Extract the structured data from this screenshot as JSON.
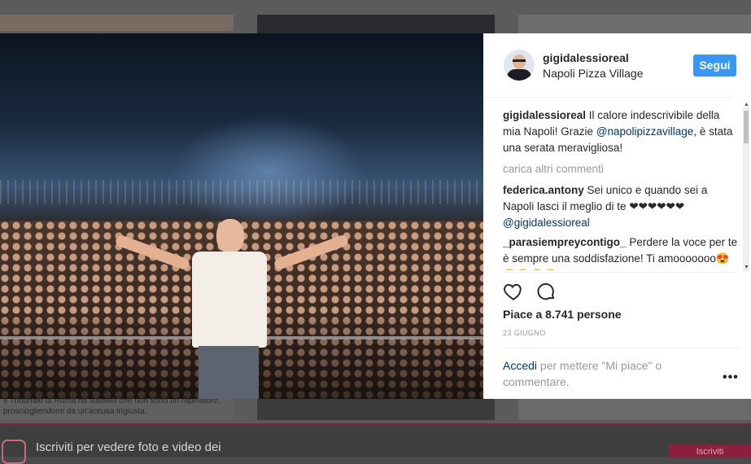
{
  "background": {
    "caption": "Il Tribunale di Roma ha stabilito che non sono un rapinatore, prosciogliendomi da un'accusa ingiusta.",
    "signup_text": "Iscriviti per vedere foto e video dei",
    "signup_button": "Iscriviti"
  },
  "post": {
    "username": "gigidalessioreal",
    "location": "Napoli Pizza Village",
    "follow_label": "Segui",
    "caption": {
      "user": "gigidalessioreal",
      "text_before": " Il calore indescrivibile della mia Napoli! Grazie ",
      "mention": "@napolipizzavillage",
      "text_after": ", è stata una serata meravigliosa!"
    },
    "load_more": "carica altri commenti",
    "comments": [
      {
        "user": "federica.antony",
        "text": " Sei unico e quando sei a Napoli lasci il meglio di te ❤❤❤❤❤❤ ",
        "mention": "@gigidalessioreal"
      },
      {
        "user": "_parasiempreycontigo_",
        "text": " Perdere la voce per te è sempre una soddisfazione! Ti amooooooo😍😍😍😍😍",
        "mention": ""
      }
    ],
    "likes": "Piace a 8.741 persone",
    "date": "23 GIUGNO",
    "login_link": "Accedi",
    "login_text": " per mettere \"Mi piace\" o commentare.",
    "more_label": "•••"
  },
  "icons": {
    "like": "heart-icon",
    "comment": "comment-bubble-icon",
    "options": "more-options-icon"
  },
  "colors": {
    "accent": "#3897f0",
    "link": "#003569",
    "muted": "#999999",
    "text": "#262626"
  }
}
